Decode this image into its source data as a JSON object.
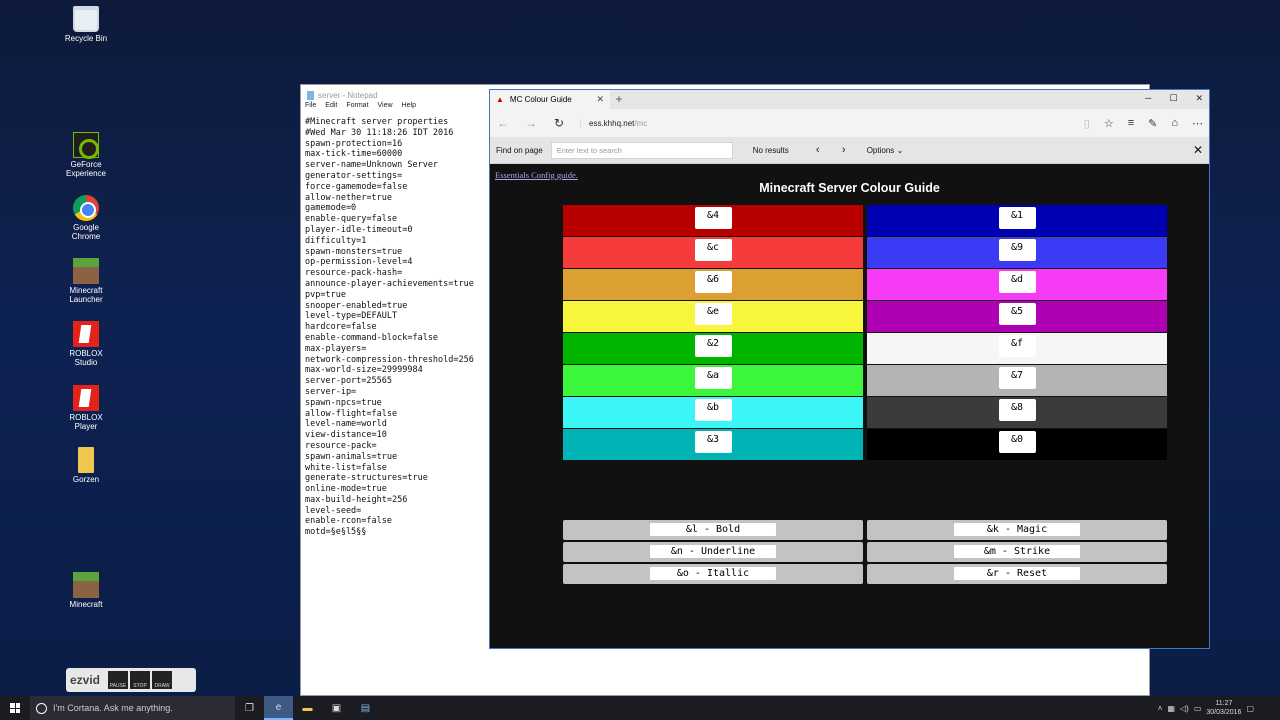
{
  "desktop": {
    "icons": [
      {
        "label": "Recycle Bin"
      },
      {
        "label": "GeForce Experience"
      },
      {
        "label": "Google Chrome"
      },
      {
        "label": "Minecraft Launcher"
      },
      {
        "label": "ROBLOX Studio"
      },
      {
        "label": "ROBLOX Player"
      },
      {
        "label": "Gorzen"
      },
      {
        "label": "Minecraft"
      }
    ],
    "ezvid": {
      "logo": "ezvid",
      "buttons": [
        "PAUSE",
        "STOP",
        "DRAW"
      ]
    }
  },
  "notepad": {
    "title": "server - Notepad",
    "menu": [
      "File",
      "Edit",
      "Format",
      "View",
      "Help"
    ],
    "content": "#Minecraft server properties\n#Wed Mar 30 11:18:26 IDT 2016\nspawn-protection=16\nmax-tick-time=60000\nserver-name=Unknown Server\ngenerator-settings=\nforce-gamemode=false\nallow-nether=true\ngamemode=0\nenable-query=false\nplayer-idle-timeout=0\ndifficulty=1\nspawn-monsters=true\nop-permission-level=4\nresource-pack-hash=\nannounce-player-achievements=true\npvp=true\nsnooper-enabled=true\nlevel-type=DEFAULT\nhardcore=false\nenable-command-block=false\nmax-players=\nnetwork-compression-threshold=256\nmax-world-size=29999984\nserver-port=25565\nserver-ip=\nspawn-npcs=true\nallow-flight=false\nlevel-name=world\nview-distance=10\nresource-pack=\nspawn-animals=true\nwhite-list=false\ngenerate-structures=true\nonline-mode=true\nmax-build-height=256\nlevel-seed=\nenable-rcon=false\nmotd=§e§l5§§"
  },
  "browser": {
    "tab_title": "MC Colour Guide",
    "url_domain": "ess.khhq.net",
    "url_path": "/mc",
    "find": {
      "label": "Find on page",
      "placeholder": "Enter text to search",
      "results": "No results",
      "options": "Options"
    },
    "page": {
      "link": "Essentials Config guide.",
      "title": "Minecraft Server Colour Guide",
      "colors": [
        {
          "code": "&4",
          "bg": "#b80000"
        },
        {
          "code": "&1",
          "bg": "#0000b5"
        },
        {
          "code": "&c",
          "bg": "#f53b3b"
        },
        {
          "code": "&9",
          "bg": "#3b3bf6"
        },
        {
          "code": "&6",
          "bg": "#dca032"
        },
        {
          "code": "&d",
          "bg": "#f53bf6"
        },
        {
          "code": "&e",
          "bg": "#f6f63b"
        },
        {
          "code": "&5",
          "bg": "#b000b4"
        },
        {
          "code": "&2",
          "bg": "#00b500"
        },
        {
          "code": "&f",
          "bg": "#f6f6f6"
        },
        {
          "code": "&a",
          "bg": "#3bf63b"
        },
        {
          "code": "&7",
          "bg": "#b4b4b4"
        },
        {
          "code": "&b",
          "bg": "#3bf6f6"
        },
        {
          "code": "&8",
          "bg": "#3b3b3b"
        },
        {
          "code": "&3",
          "bg": "#00b4b5"
        },
        {
          "code": "&0",
          "bg": "#000000"
        }
      ],
      "formats": [
        "&l - Bold",
        "&k - Magic",
        "&n - Underline",
        "&m - Strike",
        "&o - Itallic",
        "&r - Reset"
      ]
    }
  },
  "taskbar": {
    "search_placeholder": "I'm Cortana. Ask me anything.",
    "time": "11:27",
    "date": "30/03/2016"
  }
}
